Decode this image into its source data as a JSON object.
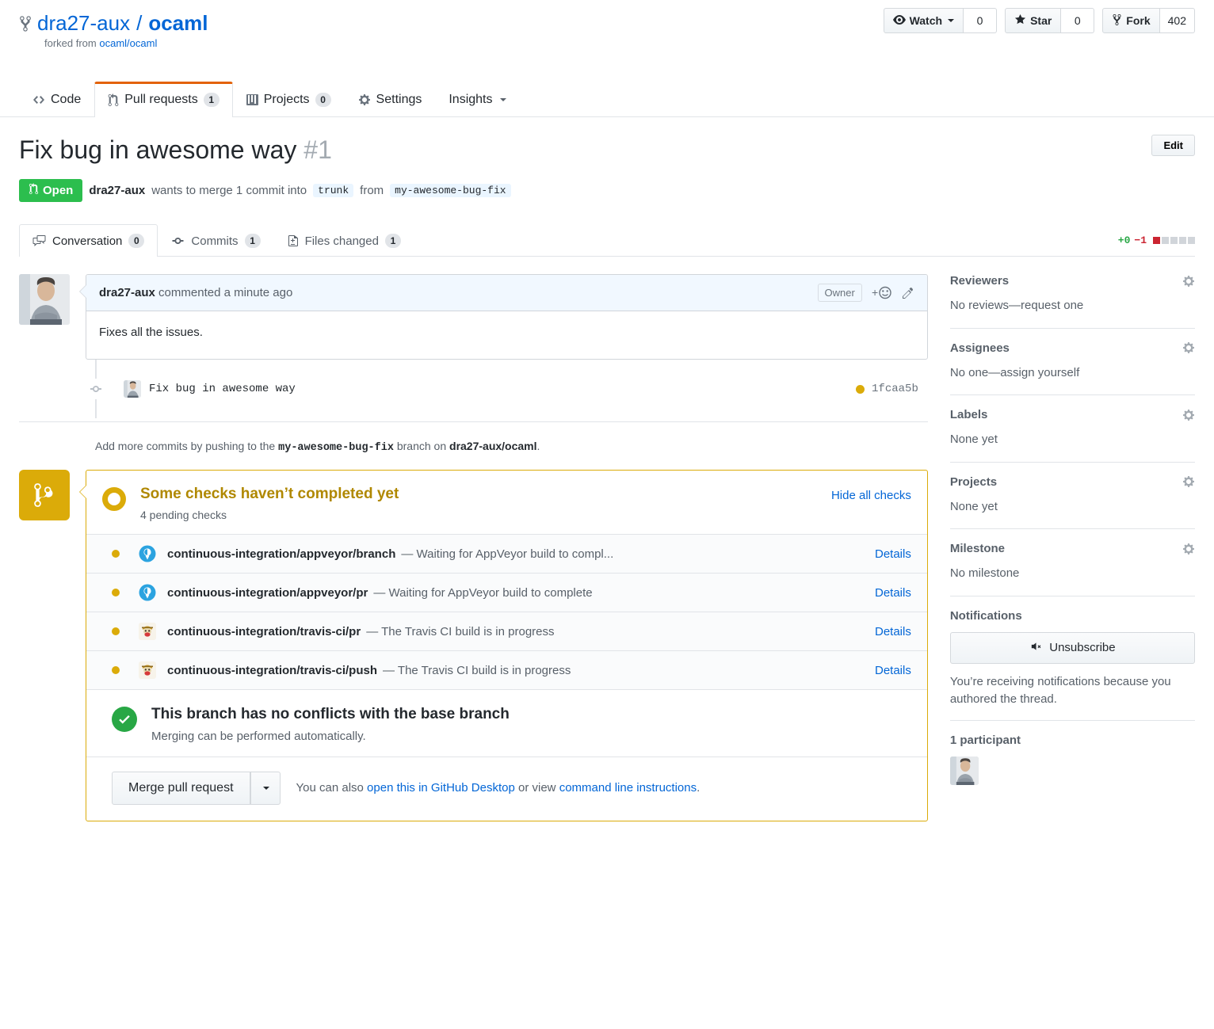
{
  "repo": {
    "owner": "dra27-aux",
    "separator": "/",
    "name": "ocaml",
    "forked_from_label": "forked from",
    "forked_from_link": "ocaml/ocaml",
    "actions": [
      {
        "label": "Watch",
        "count": "0",
        "icon": "eye-icon",
        "has_caret": true
      },
      {
        "label": "Star",
        "count": "0",
        "icon": "star-icon",
        "has_caret": false
      },
      {
        "label": "Fork",
        "count": "402",
        "icon": "fork-icon",
        "has_caret": false
      }
    ],
    "nav_tabs": [
      {
        "label": "Code",
        "icon": "code-icon",
        "count": null,
        "selected": false
      },
      {
        "label": "Pull requests",
        "icon": "git-pull-request-icon",
        "count": "1",
        "selected": true
      },
      {
        "label": "Projects",
        "icon": "project-board-icon",
        "count": "0",
        "selected": false
      },
      {
        "label": "Settings",
        "icon": "gear-icon",
        "count": null,
        "selected": false
      },
      {
        "label": "Insights",
        "icon": null,
        "count": null,
        "selected": false,
        "has_caret": true
      }
    ]
  },
  "pull_request": {
    "title": "Fix bug in awesome way",
    "number": "#1",
    "edit_label": "Edit",
    "state": "Open",
    "meta_author": "dra27-aux",
    "meta_text_1": "wants to merge 1 commit into",
    "base_branch": "trunk",
    "meta_text_2": "from",
    "head_branch": "my-awesome-bug-fix",
    "tabs": [
      {
        "label": "Conversation",
        "count": "0",
        "icon": "comment-discussion-icon",
        "selected": true
      },
      {
        "label": "Commits",
        "count": "1",
        "icon": "git-commit-icon",
        "selected": false
      },
      {
        "label": "Files changed",
        "count": "1",
        "icon": "diff-file-icon",
        "selected": false
      }
    ],
    "diffstat": {
      "additions": "+0",
      "deletions": "−1",
      "blocks": [
        "del",
        "neutral",
        "neutral",
        "neutral",
        "neutral"
      ]
    }
  },
  "comment": {
    "author": "dra27-aux",
    "action_text": "commented a minute ago",
    "owner_badge": "Owner",
    "body": "Fixes all the issues."
  },
  "commit": {
    "message": "Fix bug in awesome way",
    "sha": "1fcaa5b",
    "status": "pending"
  },
  "add_commits": {
    "prefix": "Add more commits by pushing to the",
    "branch": "my-awesome-bug-fix",
    "middle": "branch on",
    "repo": "dra27-aux/ocaml",
    "suffix": "."
  },
  "merge_status": {
    "title": "Some checks haven’t completed yet",
    "subtitle": "4 pending checks",
    "hide_checks_label": "Hide all checks",
    "checks": [
      {
        "context": "continuous-integration/appveyor/branch",
        "separator": "—",
        "description": "Waiting for AppVeyor build to compl...",
        "details_label": "Details",
        "status": "pending",
        "provider": "appveyor"
      },
      {
        "context": "continuous-integration/appveyor/pr",
        "separator": "—",
        "description": "Waiting for AppVeyor build to complete",
        "details_label": "Details",
        "status": "pending",
        "provider": "appveyor"
      },
      {
        "context": "continuous-integration/travis-ci/pr",
        "separator": "—",
        "description": "The Travis CI build is in progress",
        "details_label": "Details",
        "status": "pending",
        "provider": "travis"
      },
      {
        "context": "continuous-integration/travis-ci/push",
        "separator": "—",
        "description": "The Travis CI build is in progress",
        "details_label": "Details",
        "status": "pending",
        "provider": "travis"
      }
    ],
    "conflict_title": "This branch has no conflicts with the base branch",
    "conflict_subtitle": "Merging can be performed automatically.",
    "merge_button_label": "Merge pull request",
    "note_prefix": "You can also",
    "note_link_1": "open this in GitHub Desktop",
    "note_middle": "or view",
    "note_link_2": "command line instructions",
    "note_suffix": "."
  },
  "sidebar": {
    "sections": [
      {
        "title": "Reviewers",
        "empty": "No reviews—request one",
        "has_gear": true
      },
      {
        "title": "Assignees",
        "empty": "No one—assign yourself",
        "has_gear": true
      },
      {
        "title": "Labels",
        "empty": "None yet",
        "has_gear": true
      },
      {
        "title": "Projects",
        "empty": "None yet",
        "has_gear": true
      },
      {
        "title": "Milestone",
        "empty": "No milestone",
        "has_gear": true
      }
    ],
    "notifications": {
      "title": "Notifications",
      "button_label": "Unsubscribe",
      "note": "You’re receiving notifications because you authored the thread."
    },
    "participants": {
      "title": "1 participant"
    }
  },
  "colors": {
    "accent": "#0366d6",
    "pending": "#dbab09",
    "success": "#2cbe4e",
    "danger": "#cb2431",
    "tab_active": "#e36209"
  }
}
